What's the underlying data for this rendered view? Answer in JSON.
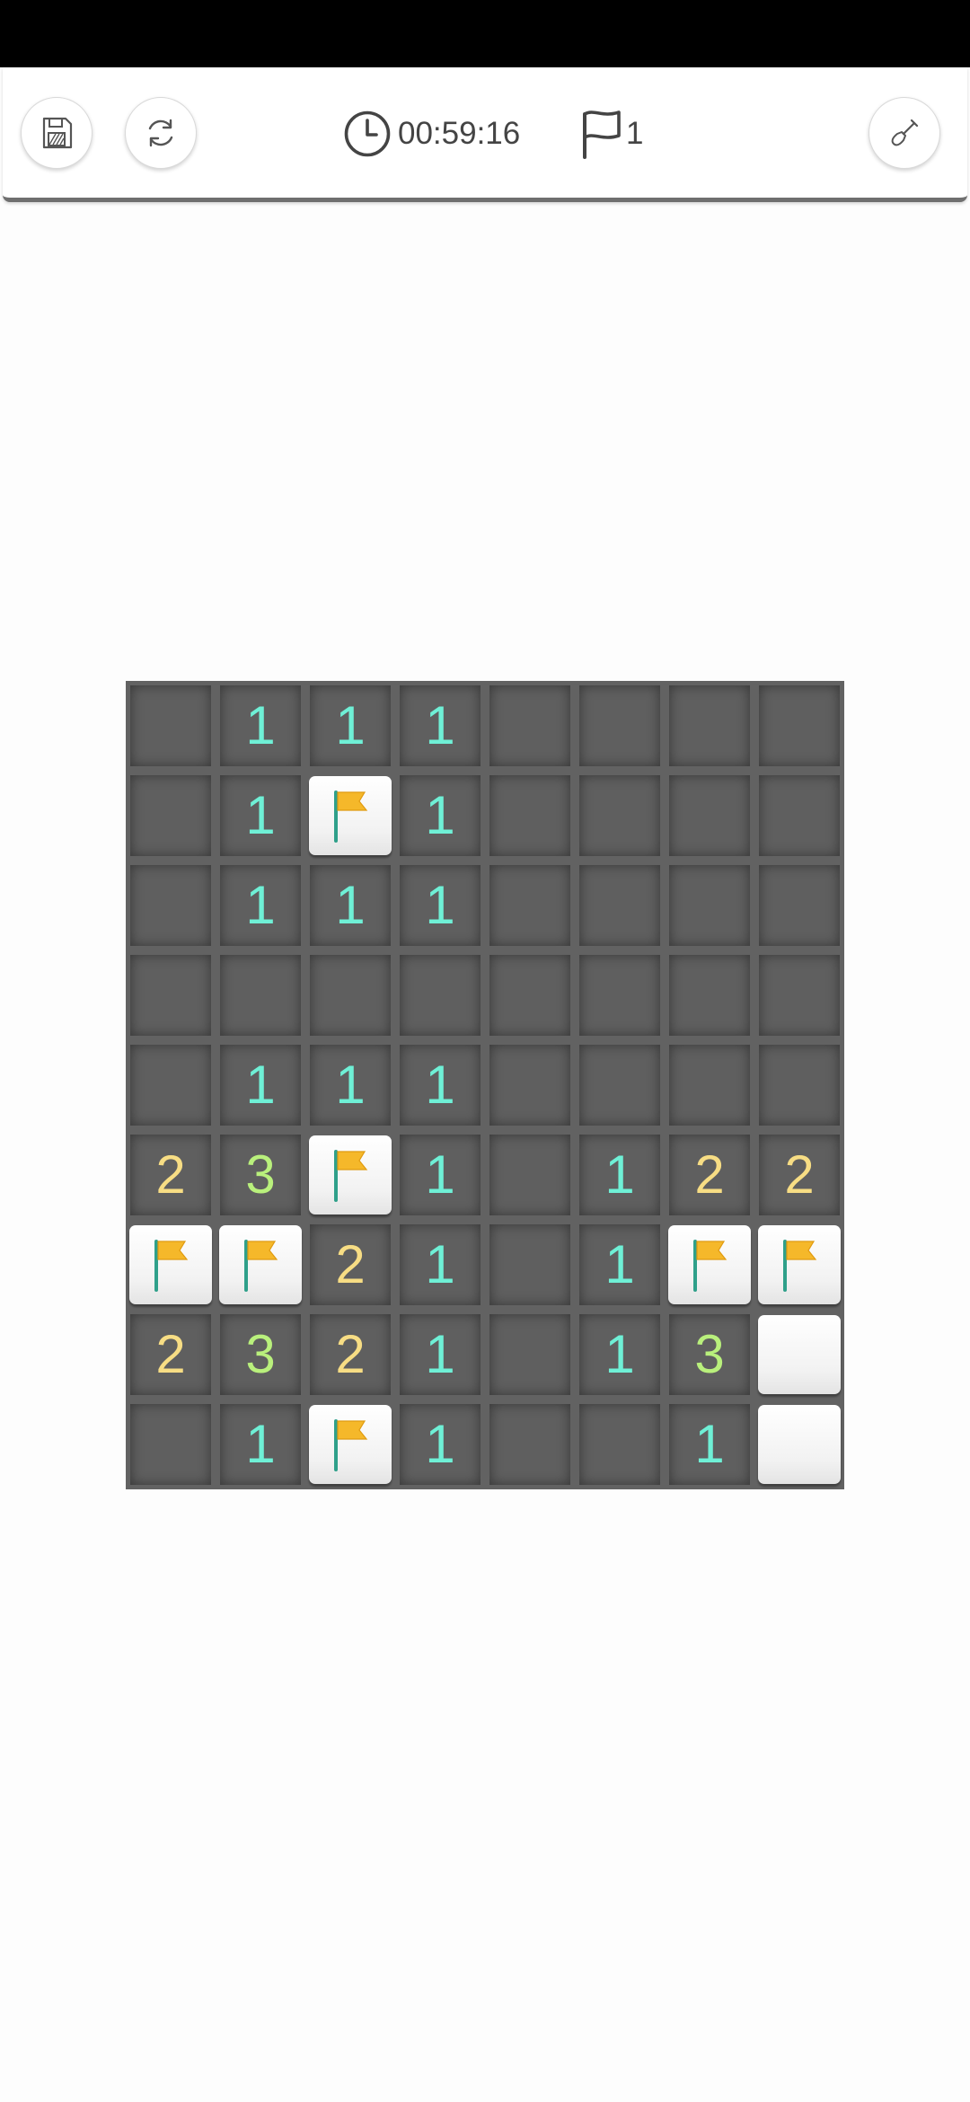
{
  "toolbar": {
    "save_icon": "save-icon",
    "restart_icon": "restart-icon",
    "timer_icon": "clock-icon",
    "timer": "00:59:16",
    "flag_icon": "flag-outline-icon",
    "flags": "1",
    "mode_icon": "shovel-icon"
  },
  "colors": {
    "one": "#6ff0d6",
    "two": "#f7dd84",
    "three": "#b9f07c",
    "flag": "#f5b82a",
    "board": "#626262"
  },
  "board": {
    "cols": 8,
    "rows": 9,
    "cells": [
      [
        "",
        "1",
        "1",
        "1",
        "",
        "",
        "",
        ""
      ],
      [
        "",
        "1",
        "F",
        "1",
        "",
        "",
        "",
        ""
      ],
      [
        "",
        "1",
        "1",
        "1",
        "",
        "",
        "",
        ""
      ],
      [
        "",
        "",
        "",
        "",
        "",
        "",
        "",
        ""
      ],
      [
        "",
        "1",
        "1",
        "1",
        "",
        "",
        "",
        ""
      ],
      [
        "2",
        "3",
        "F",
        "1",
        "",
        "1",
        "2",
        "2"
      ],
      [
        "F",
        "F",
        "2",
        "1",
        "",
        "1",
        "F",
        "F"
      ],
      [
        "2",
        "3",
        "2",
        "1",
        "",
        "1",
        "3",
        "C"
      ],
      [
        "",
        "1",
        "F",
        "1",
        "",
        "",
        "1",
        "C"
      ]
    ]
  }
}
